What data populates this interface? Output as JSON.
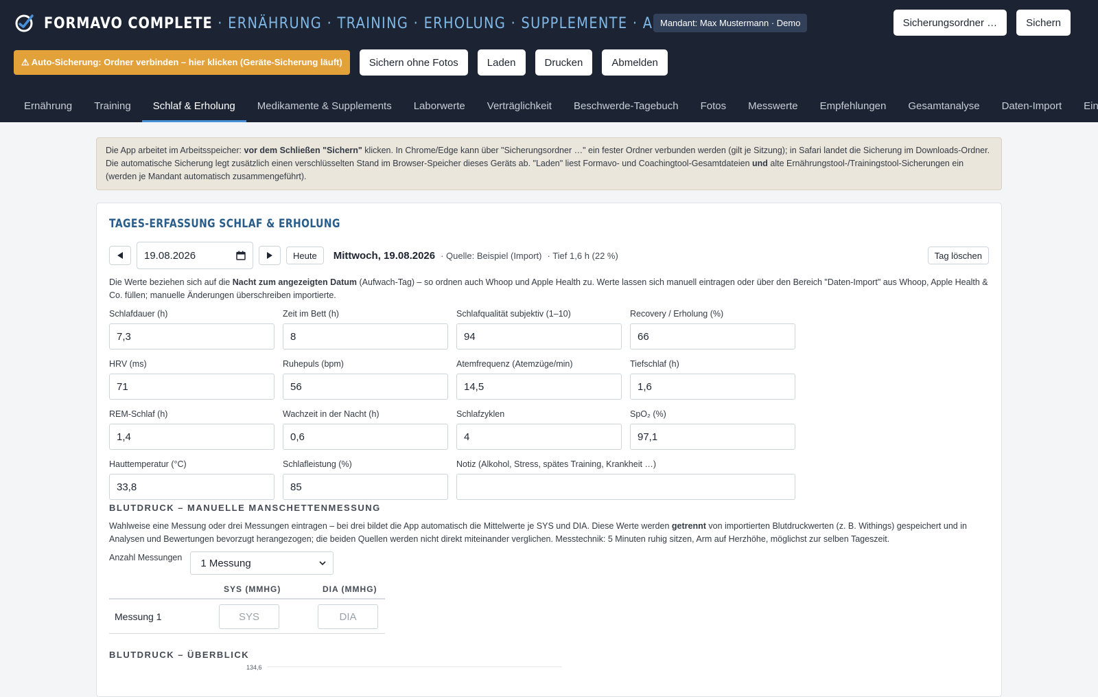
{
  "header": {
    "brand": "FORMAVO COMPLETE",
    "brand_nav": "· ERNÄHRUNG · TRAINING · ERHOLUNG · SUPPLEMENTE · AUSWERTUNGEN",
    "mandant": "Mandant: Max Mustermann · Demo",
    "folder_button": "Sicherungsordner …",
    "save_button": "Sichern"
  },
  "actions": {
    "auto_backup": "⚠ Auto-Sicherung: Ordner verbinden – hier klicken (Geräte-Sicherung läuft)",
    "save_no_photos": "Sichern ohne Fotos",
    "load": "Laden",
    "print": "Drucken",
    "logout": "Abmelden"
  },
  "tabs": [
    {
      "label": "Ernährung"
    },
    {
      "label": "Training"
    },
    {
      "label": "Schlaf & Erholung",
      "active": true
    },
    {
      "label": "Medikamente & Supplements"
    },
    {
      "label": "Laborwerte"
    },
    {
      "label": "Verträglichkeit"
    },
    {
      "label": "Beschwerde-Tagebuch"
    },
    {
      "label": "Fotos"
    },
    {
      "label": "Messwerte"
    },
    {
      "label": "Empfehlungen"
    },
    {
      "label": "Gesamtanalyse"
    },
    {
      "label": "Daten-Import"
    },
    {
      "label": "Ein"
    }
  ],
  "notice": {
    "p1": "Die App arbeitet im Arbeitsspeicher: ",
    "b1": "vor dem Schließen \"Sichern\"",
    "p2": " klicken. In Chrome/Edge kann über \"Sicherungsordner …\" ein fester Ordner verbunden werden (gilt je Sitzung); in Safari landet die Sicherung im Downloads-Ordner. Die automatische Sicherung legt zusätzlich einen verschlüsselten Stand im Browser-Speicher dieses Geräts ab. \"Laden\" liest Formavo- und Coachingtool-Gesamtdateien ",
    "b2": "und",
    "p3": " alte Ernährungstool-/Trainingstool-Sicherungen ein (werden je Mandant automatisch zusammengeführt)."
  },
  "card": {
    "title": "TAGES-ERFASSUNG SCHLAF & ERHOLUNG",
    "date_value": "19.08.2026",
    "today_button": "Heute",
    "date_label": "Mittwoch, 19.08.2026",
    "source": "· Quelle: Beispiel (Import)",
    "deep_sleep": "· Tief 1,6 h (22 %)",
    "delete_button": "Tag löschen",
    "desc_p1": "Die Werte beziehen sich auf die ",
    "desc_b": "Nacht zum angezeigten Datum",
    "desc_p2": " (Aufwach-Tag) – so ordnen auch Whoop und Apple Health zu. Werte lassen sich manuell eintragen oder über den Bereich \"Daten-Import\" aus Whoop, Apple Health & Co. füllen; manuelle Änderungen überschreiben importierte."
  },
  "fields": [
    {
      "label": "Schlafdauer (h)",
      "value": "7,3"
    },
    {
      "label": "Zeit im Bett (h)",
      "value": "8"
    },
    {
      "label": "Schlafqualität subjektiv (1–10)",
      "value": "94"
    },
    {
      "label": "Recovery / Erholung (%)",
      "value": "66"
    },
    {
      "label": "HRV (ms)",
      "value": "71"
    },
    {
      "label": "Ruhepuls (bpm)",
      "value": "56"
    },
    {
      "label": "Atemfrequenz (Atemzüge/min)",
      "value": "14,5"
    },
    {
      "label": "Tiefschlaf (h)",
      "value": "1,6"
    },
    {
      "label": "REM-Schlaf (h)",
      "value": "1,4"
    },
    {
      "label": "Wachzeit in der Nacht (h)",
      "value": "0,6"
    },
    {
      "label": "Schlafzyklen",
      "value": "4"
    },
    {
      "label": "SpO₂ (%)",
      "value": "97,1"
    },
    {
      "label": "Hauttemperatur (°C)",
      "value": "33,8"
    },
    {
      "label": "Schlafleistung (%)",
      "value": "85"
    },
    {
      "label": "Notiz (Alkohol, Stress, spätes Training, Krankheit …)",
      "value": ""
    }
  ],
  "bp": {
    "title": "BLUTDRUCK – MANUELLE MANSCHETTENMESSUNG",
    "desc_p1": "Wahlweise eine Messung oder drei Messungen eintragen – bei drei bildet die App automatisch die Mittelwerte je SYS und DIA. Diese Werte werden ",
    "desc_b": "getrennt",
    "desc_p2": " von importierten Blutdruckwerten (z. B. Withings) gespeichert und in Analysen und Bewertungen bevorzugt herangezogen; die beiden Quellen werden nicht direkt miteinander verglichen. Messtechnik: 5 Minuten ruhig sitzen, Arm auf Herzhöhe, möglichst zur selben Tageszeit.",
    "count_label": "Anzahl Messungen",
    "count_value": "1 Messung",
    "col_sys": "SYS (MMHG)",
    "col_dia": "DIA (MMHG)",
    "row_label": "Messung 1",
    "sys_placeholder": "SYS",
    "dia_placeholder": "DIA",
    "overview_title": "BLUTDRUCK – ÜBERBLICK",
    "chart_tick": "134,6"
  }
}
